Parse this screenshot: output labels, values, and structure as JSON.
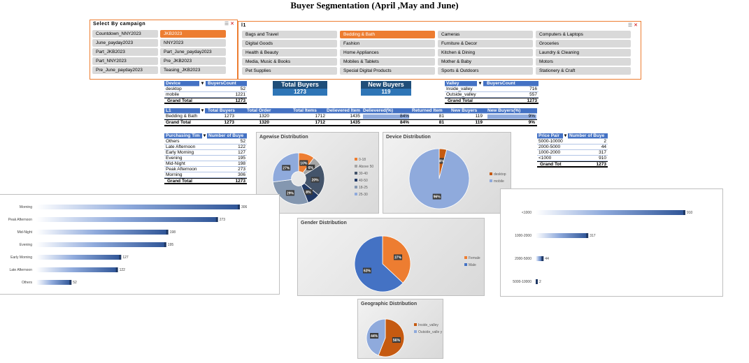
{
  "title": "Buyer Segmentation (April ,May and June)",
  "colors": {
    "accent": "#ed7d31",
    "blue": "#4472c4",
    "lightblue": "#8faadc",
    "darkblue": "#2f5597"
  },
  "slicer_campaign": {
    "title": "Select By campaign",
    "items": [
      "Countdown_NNY2023",
      "JKB2023",
      "June_payday2023",
      "NNY2023",
      "Part_JKB2023",
      "Part_June_payday2023",
      "Part_NNY2023",
      "Pre_JKB2023",
      "Pre_June_payday2023",
      "Teasing_JKB2023"
    ],
    "selected": "JKB2023"
  },
  "slicer_l1": {
    "title": "l1",
    "items": [
      "Bags and Travel",
      "Bedding & Bath",
      "Cameras",
      "Computers & Laptops",
      "Digital Goods",
      "Fashion",
      "Furniture & Decor",
      "Groceries",
      "Health & Beauty",
      "Home Appliances",
      "Kitchen & Dining",
      "Laundry & Cleaning",
      "Media, Music & Books",
      "Mobiles & Tablets",
      "Mother & Baby",
      "Motors",
      "Pet Supplies",
      "Special Digital Products",
      "Sports & Outdoors",
      "Stationery & Craft"
    ],
    "selected": "Bedding & Bath"
  },
  "device_table": {
    "headers": [
      "Device",
      "BuyersCount"
    ],
    "rows": [
      [
        "desktop",
        "52"
      ],
      [
        "mobile",
        "1221"
      ]
    ],
    "total": [
      "Grand Total",
      "1273"
    ]
  },
  "kpis": {
    "total_label": "Total Buyers",
    "total_value": "1273",
    "new_label": "New Buyers",
    "new_value": "119"
  },
  "valley_table": {
    "headers": [
      "Valley",
      "BuyersCount"
    ],
    "rows": [
      [
        "Inside_valley",
        "716"
      ],
      [
        "Outside_valley",
        "557"
      ]
    ],
    "total": [
      "Grand Total",
      "1273"
    ]
  },
  "l1_table": {
    "headers": [
      "L1",
      "Total Buyers",
      "Total Order",
      "Total Items",
      "Delievered Item",
      "Delievered(%)",
      "Returned Item",
      "New Buyers",
      "New Buyers(%)"
    ],
    "row": [
      "Bedding & Bath",
      "1273",
      "1320",
      "1712",
      "1435",
      "84%",
      "81",
      "119",
      "9%"
    ],
    "total": [
      "Grand Total",
      "1273",
      "1320",
      "1712",
      "1435",
      "84%",
      "81",
      "119",
      "9%"
    ]
  },
  "time_table": {
    "headers": [
      "Purchasing Tim",
      "Number of Buye"
    ],
    "rows": [
      [
        "Others",
        "52"
      ],
      [
        "Late Afternoon",
        "122"
      ],
      [
        "Early Morning",
        "127"
      ],
      [
        "Evening",
        "195"
      ],
      [
        "Mid-Night",
        "198"
      ],
      [
        "Peak Afternoon",
        "273"
      ],
      [
        "Morning",
        "306"
      ]
    ],
    "total": [
      "Grand Total",
      "1273"
    ]
  },
  "price_table": {
    "headers": [
      "Price Pair",
      "Number of Buye"
    ],
    "rows": [
      [
        "5000-10000",
        "2"
      ],
      [
        "2000-5000",
        "44"
      ],
      [
        "1000-2000",
        "317"
      ],
      [
        "<1000",
        "910"
      ]
    ],
    "total": [
      "Grand Tot",
      "1273"
    ]
  },
  "charts": {
    "age": {
      "title": "Agewise Distribution",
      "labels": [
        "0-18",
        "Above 50",
        "30-40",
        "40-50",
        "18-25",
        "25-30"
      ],
      "values": [
        10,
        6,
        20,
        8,
        29,
        27
      ],
      "colors": [
        "#ed7d31",
        "#a5a5a5",
        "#44546a",
        "#203864",
        "#8497b0",
        "#8faadc"
      ]
    },
    "device": {
      "title": "Device Distribution",
      "labels": [
        "desktop",
        "mobile"
      ],
      "values": [
        4,
        96
      ],
      "colors": [
        "#c55a11",
        "#8faadc"
      ]
    },
    "gender": {
      "title": "Gender Distribution",
      "labels": [
        "Female",
        "Male"
      ],
      "values": [
        37,
        63
      ],
      "colors": [
        "#ed7d31",
        "#4472c4"
      ]
    },
    "geo": {
      "title": "Geographic Distribution",
      "labels": [
        "Inside_valley",
        "Outside_valle y"
      ],
      "values": [
        56,
        44
      ],
      "colors": [
        "#c55a11",
        "#8faadc"
      ]
    },
    "time_bars": {
      "categories": [
        "Morning",
        "Peak Afternoon",
        "Mid-Night",
        "Evening",
        "Early Morning",
        "Late Afternoon",
        "Others"
      ],
      "values": [
        306,
        273,
        198,
        195,
        127,
        122,
        52
      ]
    },
    "price_bars": {
      "categories": [
        "<1000",
        "1000-2000",
        "2000-5000",
        "5000-10000"
      ],
      "values": [
        910,
        317,
        44,
        2
      ]
    }
  }
}
